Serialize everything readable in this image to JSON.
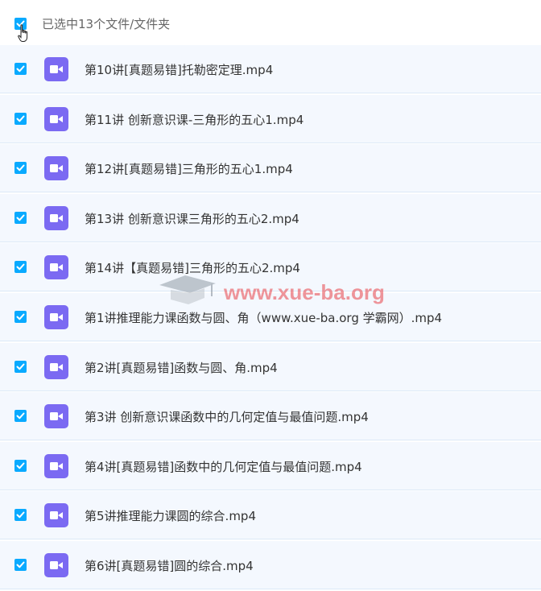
{
  "header": {
    "selected_text": "已选中13个文件/文件夹"
  },
  "files": [
    {
      "name": "第10讲[真题易错]托勒密定理.mp4"
    },
    {
      "name": "第11讲 创新意识课-三角形的五心1.mp4"
    },
    {
      "name": "第12讲[真题易错]三角形的五心1.mp4"
    },
    {
      "name": "第13讲 创新意识课三角形的五心2.mp4"
    },
    {
      "name": "第14讲【真题易错]三角形的五心2.mp4"
    },
    {
      "name": "第1讲推理能力课函数与圆、角（www.xue-ba.org 学霸网）.mp4"
    },
    {
      "name": "第2讲[真题易错]函数与圆、角.mp4"
    },
    {
      "name": "第3讲 创新意识课函数中的几何定值与最值问题.mp4"
    },
    {
      "name": "第4讲[真题易错]函数中的几何定值与最值问题.mp4"
    },
    {
      "name": "第5讲推理能力课圆的综合.mp4"
    },
    {
      "name": "第6讲[真题易错]圆的综合.mp4"
    }
  ],
  "watermark": {
    "text": "www.xue-ba.org"
  },
  "colors": {
    "checkbox": "#09aaff",
    "video_icon": "#7b6af2",
    "row_bg": "#f4f8fe"
  }
}
